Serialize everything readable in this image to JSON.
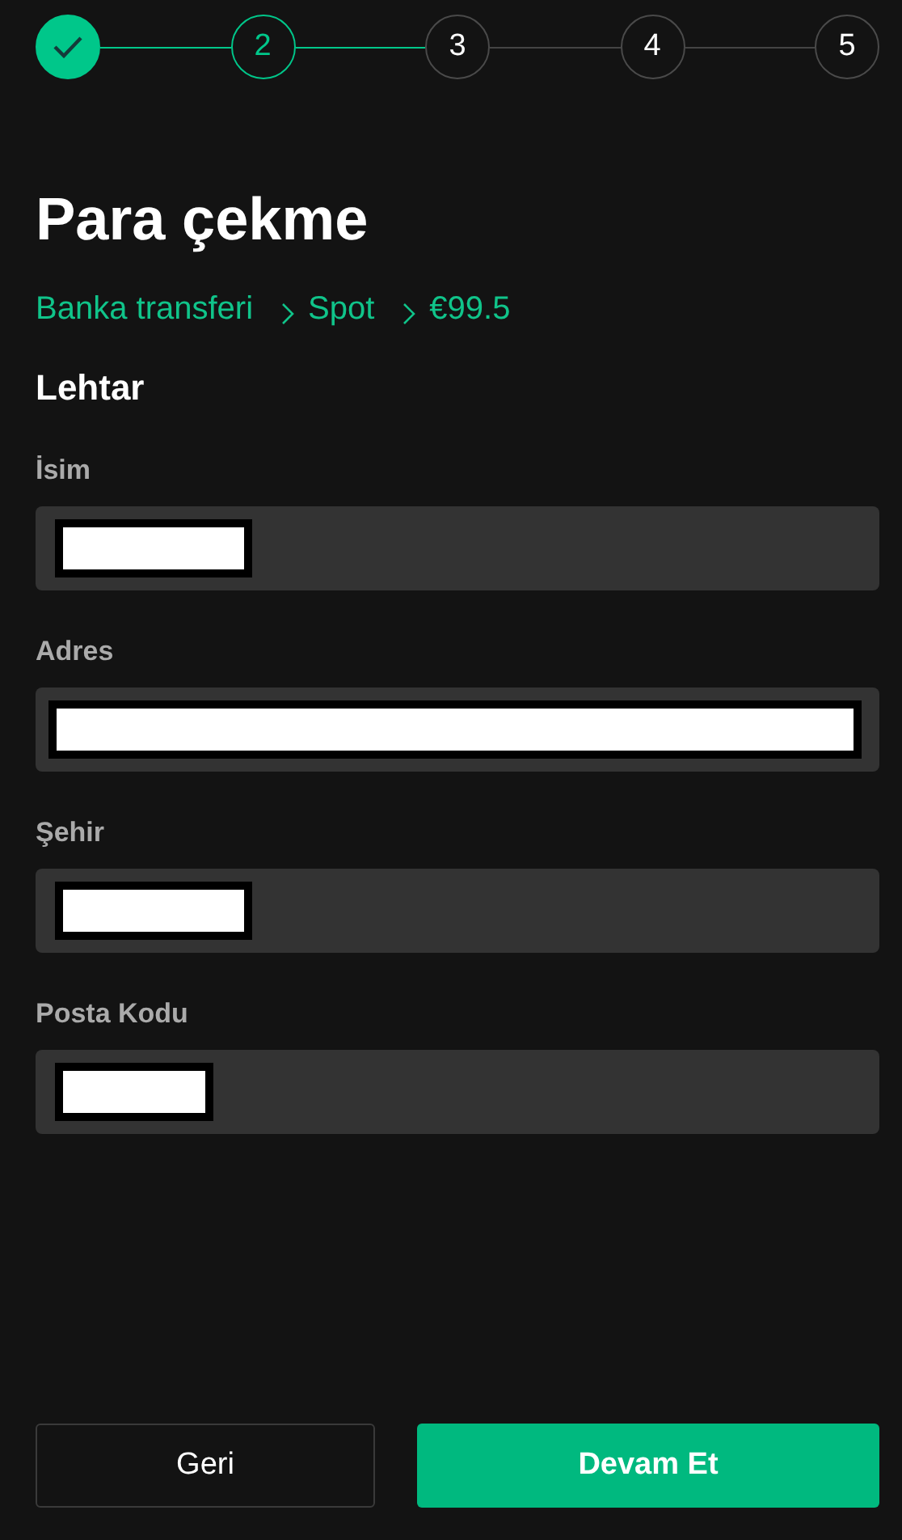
{
  "steps": [
    {
      "kind": "done"
    },
    {
      "label": "2",
      "kind": "current"
    },
    {
      "label": "3",
      "kind": "upcoming"
    },
    {
      "label": "4",
      "kind": "upcoming"
    },
    {
      "label": "5",
      "kind": "upcoming"
    }
  ],
  "title": "Para çekme",
  "breadcrumb": [
    "Banka transferi",
    "Spot",
    "€99.5"
  ],
  "section": "Lehtar",
  "fields": [
    {
      "label": "İsim",
      "kind": "medium"
    },
    {
      "label": "Adres",
      "kind": "full"
    },
    {
      "label": "Şehir",
      "kind": "medium"
    },
    {
      "label": "Posta Kodu",
      "kind": "small"
    }
  ],
  "buttons": [
    {
      "label": "Geri",
      "kind": "secondary"
    },
    {
      "label": "Devam Et",
      "kind": "primary"
    }
  ]
}
